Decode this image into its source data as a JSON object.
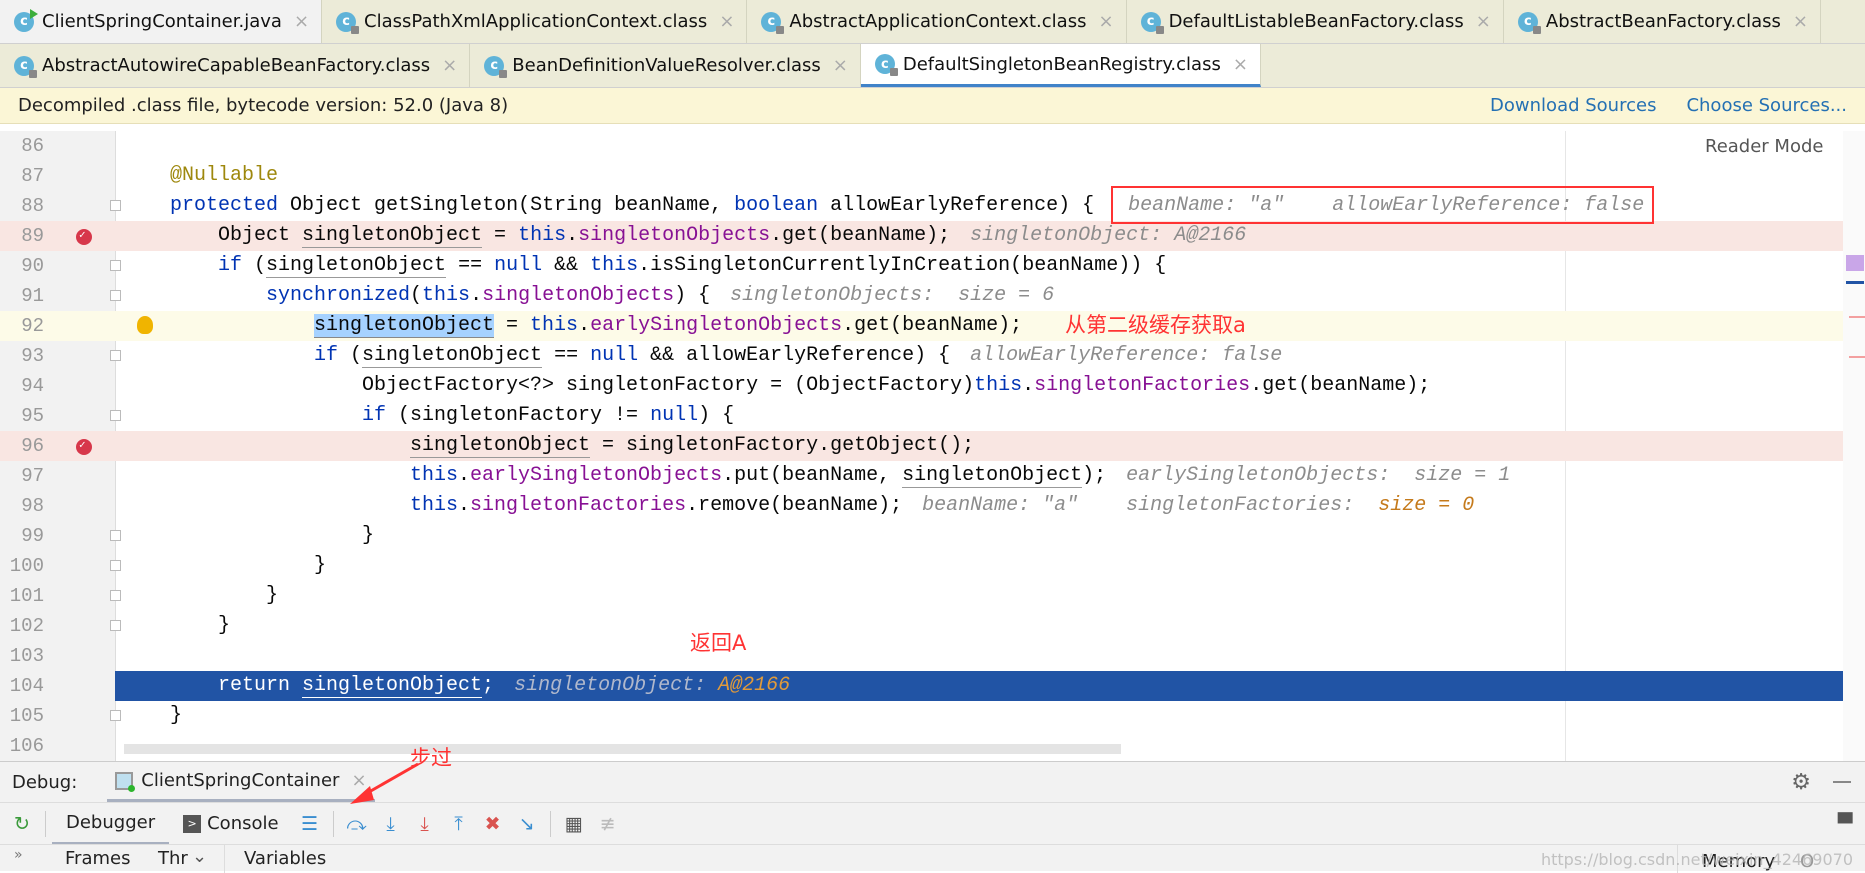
{
  "tabs_row1": [
    {
      "label": "ClientSpringContainer.java",
      "icon": "java-class-run-icon"
    },
    {
      "label": "ClassPathXmlApplicationContext.class",
      "icon": "class-icon"
    },
    {
      "label": "AbstractApplicationContext.class",
      "icon": "class-icon"
    },
    {
      "label": "DefaultListableBeanFactory.class",
      "icon": "class-icon"
    },
    {
      "label": "AbstractBeanFactory.class",
      "icon": "class-icon"
    }
  ],
  "tabs_row2": [
    {
      "label": "AbstractAutowireCapableBeanFactory.class",
      "icon": "class-icon"
    },
    {
      "label": "BeanDefinitionValueResolver.class",
      "icon": "class-icon"
    },
    {
      "label": "DefaultSingletonBeanRegistry.class",
      "icon": "class-icon",
      "active": true
    }
  ],
  "banner": {
    "text": "Decompiled .class file, bytecode version: 52.0 (Java 8)",
    "download": "Download Sources",
    "choose": "Choose Sources..."
  },
  "editor": {
    "reader_mode": "Reader Mode",
    "lines": [
      {
        "n": "86",
        "i": 0,
        "t": []
      },
      {
        "n": "87",
        "i": 1,
        "t": [
          [
            "@Nullable",
            "a"
          ]
        ]
      },
      {
        "n": "88",
        "i": 1,
        "fold": 1,
        "t": [
          [
            "protected ",
            "k"
          ],
          [
            "Object getSingleton(String beanName, ",
            ""
          ],
          [
            "boolean ",
            "k"
          ],
          [
            "allowEarlyReference) {",
            ""
          ]
        ],
        "h": [
          [
            "beanName: \"a\"    allowEarlyReference: false",
            ""
          ]
        ]
      },
      {
        "n": "89",
        "i": 2,
        "bp": 1,
        "t": [
          [
            "Object ",
            ""
          ],
          [
            "singletonObject",
            "u"
          ],
          [
            " = ",
            ""
          ],
          [
            "this",
            "k"
          ],
          [
            ".",
            ""
          ],
          [
            "singletonObjects",
            "f"
          ],
          [
            ".get(beanName);",
            ""
          ]
        ],
        "h": [
          [
            "singletonObject: A@2166",
            ""
          ]
        ]
      },
      {
        "n": "90",
        "i": 2,
        "fold": 1,
        "t": [
          [
            "if ",
            "k"
          ],
          [
            "(",
            ""
          ],
          [
            "singletonObject",
            "u"
          ],
          [
            " == ",
            ""
          ],
          [
            "null",
            "k"
          ],
          [
            " && ",
            ""
          ],
          [
            "this",
            "k"
          ],
          [
            ".isSingletonCurrentlyInCreation(beanName)) {",
            ""
          ]
        ]
      },
      {
        "n": "91",
        "i": 3,
        "fold": 1,
        "t": [
          [
            "synchronized",
            "k"
          ],
          [
            "(",
            ""
          ],
          [
            "this",
            "k"
          ],
          [
            ".",
            ""
          ],
          [
            "singletonObjects",
            "f"
          ],
          [
            ") {",
            ""
          ]
        ],
        "h": [
          [
            "singletonObjects:  size = 6",
            ""
          ]
        ]
      },
      {
        "n": "92",
        "i": 4,
        "cur": 1,
        "t": [
          [
            "singletonObject",
            "hl"
          ],
          [
            " = ",
            ""
          ],
          [
            "this",
            "k"
          ],
          [
            ".",
            ""
          ],
          [
            "earlySingletonObjects",
            "f"
          ],
          [
            ".get(beanName);",
            ""
          ]
        ]
      },
      {
        "n": "93",
        "i": 4,
        "fold": 1,
        "t": [
          [
            "if ",
            "k"
          ],
          [
            "(",
            ""
          ],
          [
            "singletonObject",
            "u"
          ],
          [
            " == ",
            ""
          ],
          [
            "null",
            "k"
          ],
          [
            " && allowEarlyReference) {",
            ""
          ]
        ],
        "h": [
          [
            "allowEarlyReference: false",
            ""
          ]
        ]
      },
      {
        "n": "94",
        "i": 5,
        "t": [
          [
            "ObjectFactory<?> singletonFactory = (ObjectFactory)",
            ""
          ],
          [
            "this",
            "k"
          ],
          [
            ".",
            ""
          ],
          [
            "singletonFactories",
            "f"
          ],
          [
            ".get(beanName);",
            ""
          ]
        ]
      },
      {
        "n": "95",
        "i": 5,
        "fold": 1,
        "t": [
          [
            "if ",
            "k"
          ],
          [
            "(singletonFactory != ",
            ""
          ],
          [
            "null",
            "k"
          ],
          [
            ") {",
            ""
          ]
        ]
      },
      {
        "n": "96",
        "i": 6,
        "bp": 1,
        "t": [
          [
            "singletonObject",
            "u"
          ],
          [
            " = singletonFactory.getObject();",
            ""
          ]
        ]
      },
      {
        "n": "97",
        "i": 6,
        "t": [
          [
            "this",
            "k"
          ],
          [
            ".",
            ""
          ],
          [
            "earlySingletonObjects",
            "f"
          ],
          [
            ".put(beanName, ",
            ""
          ],
          [
            "singletonObject",
            "u"
          ],
          [
            ");",
            ""
          ]
        ],
        "h": [
          [
            "earlySingletonObjects:  size = 1",
            ""
          ]
        ]
      },
      {
        "n": "98",
        "i": 6,
        "t": [
          [
            "this",
            "k"
          ],
          [
            ".",
            ""
          ],
          [
            "singletonFactories",
            "f"
          ],
          [
            ".remove(beanName);",
            ""
          ]
        ],
        "h": [
          [
            "beanName: \"a\"    singletonFactories:  ",
            ""
          ],
          [
            "size = 0",
            "ho"
          ]
        ]
      },
      {
        "n": "99",
        "i": 5,
        "fold": 1,
        "t": [
          [
            "}",
            ""
          ]
        ]
      },
      {
        "n": "100",
        "i": 4,
        "fold": 1,
        "t": [
          [
            "}",
            ""
          ]
        ]
      },
      {
        "n": "101",
        "i": 3,
        "fold": 1,
        "t": [
          [
            "}",
            ""
          ]
        ]
      },
      {
        "n": "102",
        "i": 2,
        "fold": 1,
        "t": [
          [
            "}",
            ""
          ]
        ]
      },
      {
        "n": "103",
        "i": 0,
        "t": []
      },
      {
        "n": "104",
        "i": 2,
        "exec": 1,
        "t": [
          [
            "return ",
            "k"
          ],
          [
            "singletonObject",
            "u"
          ],
          [
            ";",
            ""
          ]
        ],
        "h": [
          [
            "singletonObject: ",
            ""
          ],
          [
            "A@2166",
            "ho"
          ]
        ]
      },
      {
        "n": "105",
        "i": 1,
        "fold": 1,
        "t": [
          [
            "}",
            ""
          ]
        ]
      },
      {
        "n": "106",
        "i": 0,
        "t": []
      }
    ]
  },
  "annotations": {
    "second_cache": "从第二级缓存获取a",
    "return_a": "返回A",
    "step_over": "步过"
  },
  "debug": {
    "label": "Debug:",
    "run_config": "ClientSpringContainer",
    "debugger_tab": "Debugger",
    "console_tab": "Console",
    "frames": "Frames",
    "threads": "Thr",
    "variables": "Variables",
    "memory": "Memory",
    "memory_extra": "O",
    "watermark": "https://blog.csdn.net/weixin_42469070"
  },
  "colors": {
    "keyword": "#0033b3",
    "field": "#871094",
    "exec_line": "#2154a5",
    "breakpoint": "#d7374a",
    "annotation_red": "#ff3333"
  }
}
